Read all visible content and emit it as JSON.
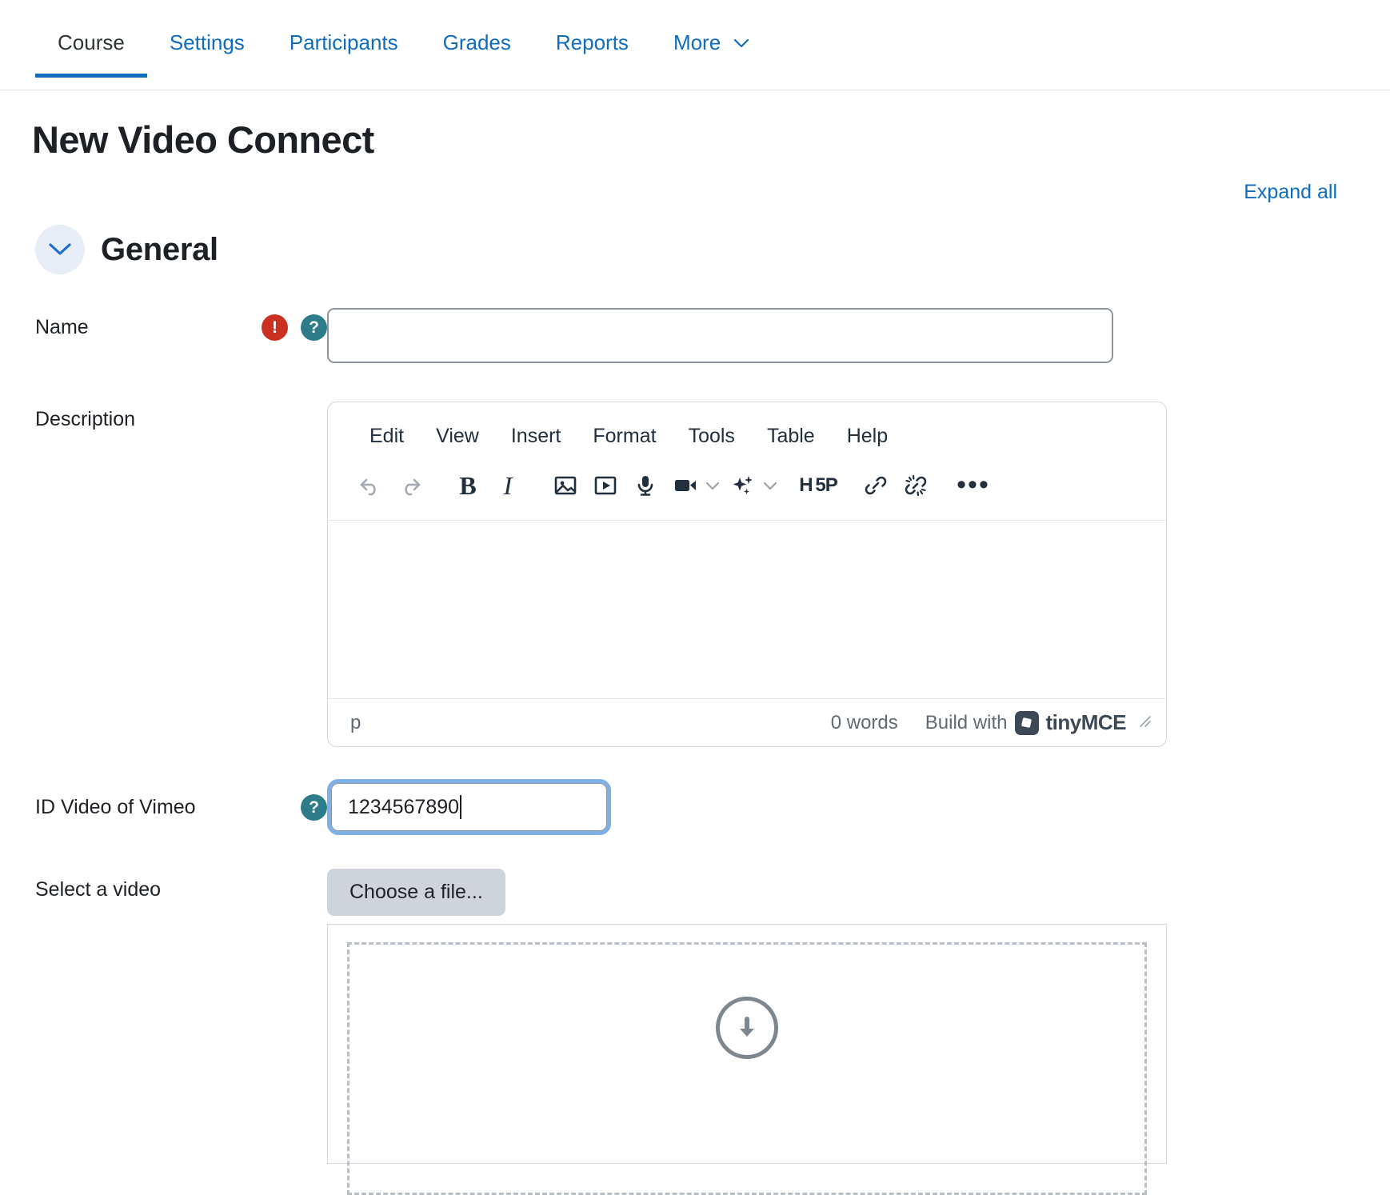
{
  "nav": {
    "tabs": [
      {
        "label": "Course",
        "active": true
      },
      {
        "label": "Settings",
        "active": false
      },
      {
        "label": "Participants",
        "active": false
      },
      {
        "label": "Grades",
        "active": false
      },
      {
        "label": "Reports",
        "active": false
      },
      {
        "label": "More",
        "active": false,
        "caret": "⌄"
      }
    ]
  },
  "page": {
    "title": "New Video Connect",
    "expand_all": "Expand all"
  },
  "section": {
    "title": "General",
    "chevron_icon": "chevron-down-icon"
  },
  "fields": {
    "name": {
      "label": "Name",
      "value": "",
      "placeholder": "",
      "required_badge": "!",
      "help_badge": "?"
    },
    "description": {
      "label": "Description"
    },
    "vimeo": {
      "label": "ID Video of Vimeo",
      "value": "1234567890",
      "help_badge": "?"
    },
    "select_video": {
      "label": "Select a video",
      "button_label": "Choose a file...",
      "dropzone_icon": "download-arrow-icon"
    }
  },
  "editor": {
    "menu": [
      "Edit",
      "View",
      "Insert",
      "Format",
      "Tools",
      "Table",
      "Help"
    ],
    "toolbar": [
      {
        "name": "undo-icon",
        "label": ""
      },
      {
        "name": "redo-icon",
        "label": ""
      },
      {
        "name": "bold-icon",
        "label": "B"
      },
      {
        "name": "italic-icon",
        "label": "I"
      },
      {
        "name": "image-icon",
        "label": ""
      },
      {
        "name": "media-icon",
        "label": ""
      },
      {
        "name": "microphone-icon",
        "label": ""
      },
      {
        "name": "video-camera-icon",
        "label": ""
      },
      {
        "name": "ai-sparkles-icon",
        "label": ""
      },
      {
        "name": "h5p-icon",
        "label": "H 5P"
      },
      {
        "name": "link-icon",
        "label": ""
      },
      {
        "name": "unlink-icon",
        "label": ""
      },
      {
        "name": "more-options-icon",
        "label": "•••"
      }
    ],
    "status": {
      "path": "p",
      "words": "0 words",
      "build_with": "Build with",
      "brand": "tinyMCE"
    },
    "content": ""
  },
  "colors": {
    "link": "#0f6cbf",
    "required": "#ca3120",
    "help": "#2d7c8a",
    "focus_ring": "#7fb0e5",
    "button_grey": "#ced4da"
  }
}
